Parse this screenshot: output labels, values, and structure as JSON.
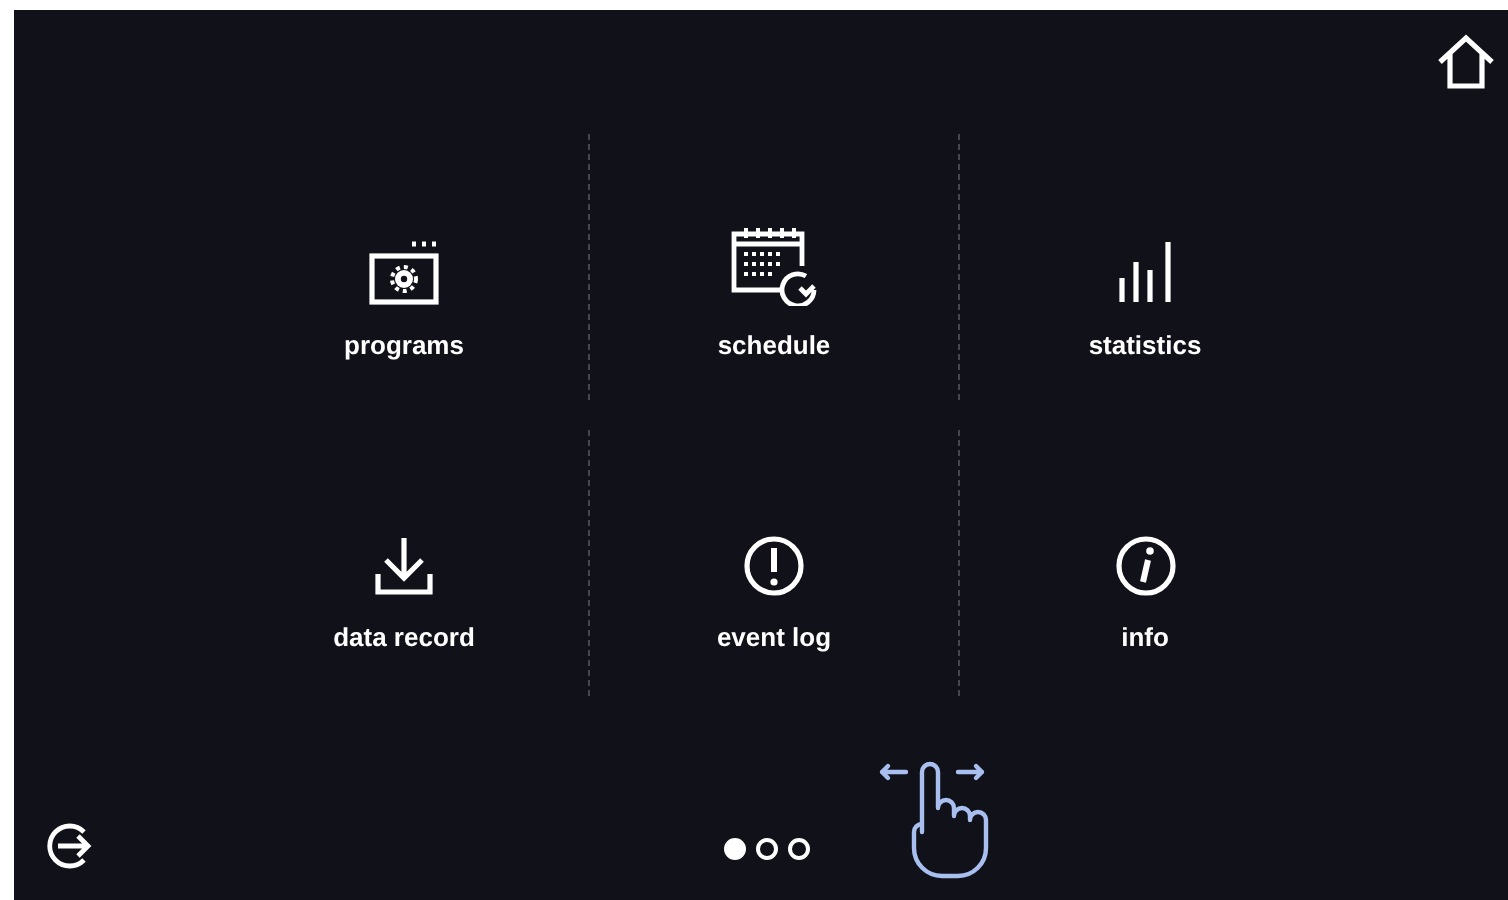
{
  "menu": {
    "tiles": [
      {
        "label": "programs",
        "kind": "programs"
      },
      {
        "label": "schedule",
        "kind": "schedule"
      },
      {
        "label": "statistics",
        "kind": "statistics"
      },
      {
        "label": "data record",
        "kind": "download"
      },
      {
        "label": "event log",
        "kind": "alert"
      },
      {
        "label": "info",
        "kind": "info"
      }
    ]
  },
  "pager": {
    "pages": [
      {
        "selected": true
      },
      {
        "selected": false
      },
      {
        "selected": false
      }
    ]
  }
}
